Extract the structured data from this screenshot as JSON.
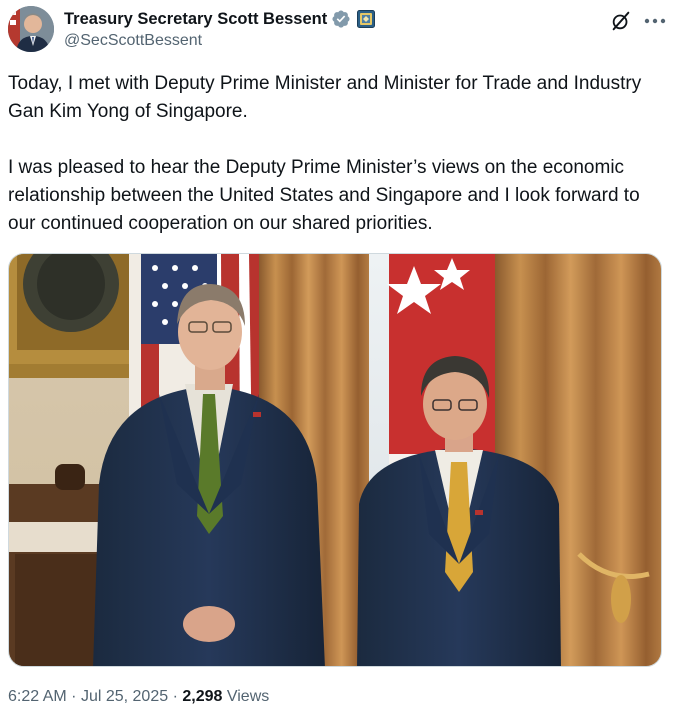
{
  "author": {
    "display_name": "Treasury Secretary Scott Bessent",
    "handle": "@SecScottBessent",
    "avatar_icon": "person-avatar",
    "verified_icon": "verified-badge-icon",
    "affiliation_icon": "government-seal-badge-icon"
  },
  "actions": {
    "grok_icon": "grok-slash-icon",
    "more_icon": "more-dots-icon"
  },
  "tweet": {
    "paragraphs": [
      "Today, I met with Deputy Prime Minister and Minister for Trade and Industry Gan Kim Yong of Singapore.",
      "I was pleased to hear the Deputy Prime Minister’s views on the economic relationship between the United States and Singapore and I look forward to our continued cooperation on our shared priorities."
    ]
  },
  "media": {
    "type": "photo"
  },
  "meta": {
    "time": "6:22 AM",
    "separator": "·",
    "date": "Jul 25, 2025",
    "views_count": "2,298",
    "views_label": "Views"
  },
  "colors": {
    "text_primary": "#0f1419",
    "text_secondary": "#536471",
    "verified_blue": "#1d9bf0",
    "border": "#cfd9de"
  }
}
